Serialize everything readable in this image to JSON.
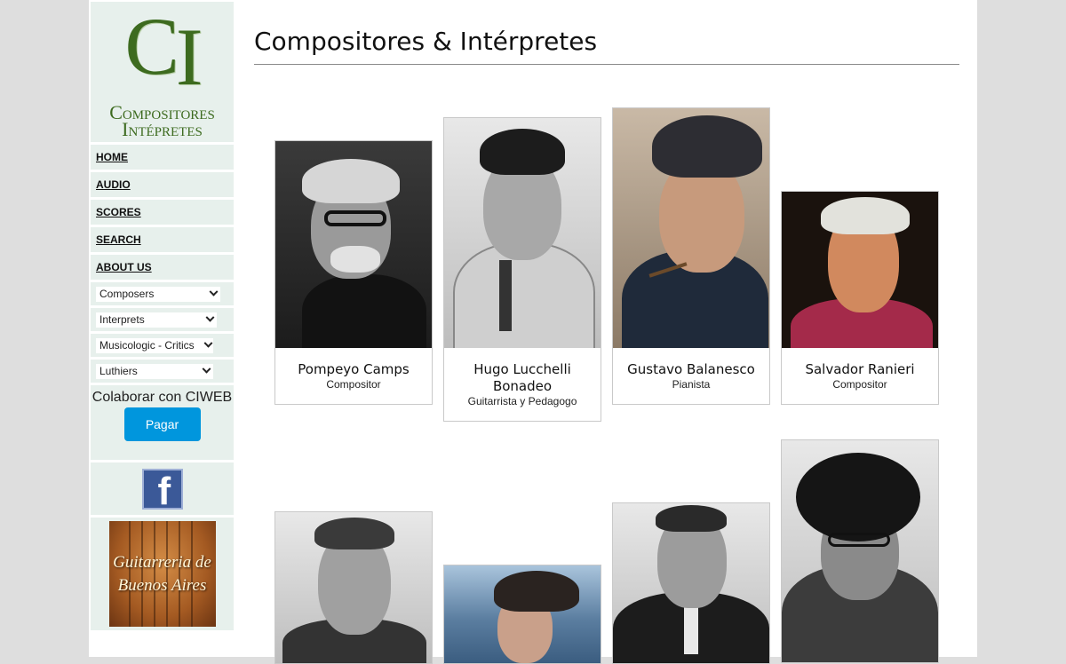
{
  "logo": {
    "mark": "CI",
    "line1": "Compositores",
    "line2": "Intépretes"
  },
  "nav": {
    "items": [
      "HOME",
      "AUDIO",
      "SCORES",
      "SEARCH",
      "ABOUT US"
    ]
  },
  "selects": [
    "Composers",
    "Interprets",
    "Musicologic - Critics",
    "Luthiers"
  ],
  "donate": {
    "text": "Colaborar con CIWEB",
    "button": "Pagar"
  },
  "social": {
    "icon": "facebook-icon"
  },
  "ad": {
    "text_line1": "Guitarreria de",
    "text_line2": "Buenos Aires"
  },
  "main": {
    "title": "Compositores & Intérpretes"
  },
  "people": [
    {
      "name": "Pompeyo Camps",
      "role": "Compositor"
    },
    {
      "name": "Hugo Lucchelli Bonadeo",
      "role": "Guitarrista y Pedagogo"
    },
    {
      "name": "Gustavo Balanesco",
      "role": "Pianista"
    },
    {
      "name": "Salvador Ranieri",
      "role": "Compositor"
    }
  ],
  "colors": {
    "page_bg": "#dedede",
    "sidebar_bg": "#e7f0ec",
    "logo_green": "#3d6b1f",
    "pay_button": "#0096dd"
  }
}
